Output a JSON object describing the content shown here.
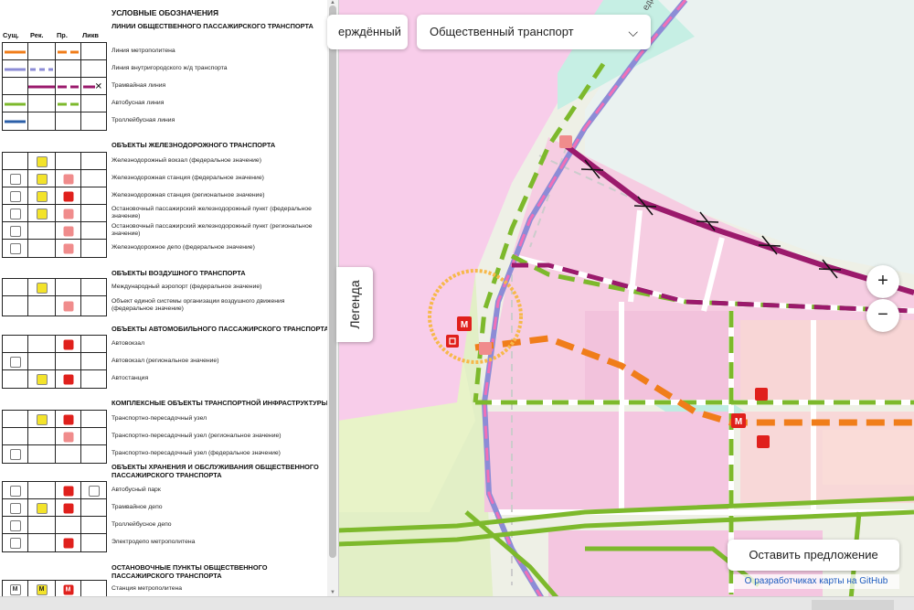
{
  "legend": {
    "title": "УСЛОВНЫЕ ОБОЗНАЧЕНИЯ",
    "columns": [
      "Сущ.",
      "Рек.",
      "Пр.",
      "Ликв"
    ],
    "sections": [
      {
        "title": "ЛИНИИ ОБЩЕСТВЕННОГО ПАССАЖИРСКОГО ТРАНСПОРТА",
        "items": [
          {
            "label": "Линия метрополитена",
            "color": "#f07d1a"
          },
          {
            "label": "Линия внутригородского ж/д транспорта",
            "color": "#8c8cd6"
          },
          {
            "label": "Трамвайная линия",
            "color": "#9b1a6c"
          },
          {
            "label": "Автобусная линия",
            "color": "#7db92c"
          },
          {
            "label": "Троллейбусная линия",
            "color": "#2b5fa8"
          }
        ]
      },
      {
        "title": "ОБЪЕКТЫ ЖЕЛЕЗНОДОРОЖНОГО ТРАНСПОРТА",
        "items": [
          {
            "label": "Железнодорожный вокзал (федеральное значение)"
          },
          {
            "label": "Железнодорожная станция (федеральное значение)"
          },
          {
            "label": "Железнодорожная станция (региональное значение)"
          },
          {
            "label": "Остановочный пассажирский железнодорожный пункт (федеральное значение)"
          },
          {
            "label": "Остановочный пассажирский железнодорожный пункт (региональное значение)"
          },
          {
            "label": "Железнодорожное депо (федеральное значение)"
          }
        ]
      },
      {
        "title": "ОБЪЕКТЫ ВОЗДУШНОГО ТРАНСПОРТА",
        "items": [
          {
            "label": "Международный аэропорт (федеральное значение)"
          },
          {
            "label": "Объект единой системы организации воздушного движения (федеральное значение)"
          }
        ]
      },
      {
        "title": "ОБЪЕКТЫ АВТОМОБИЛЬНОГО ПАССАЖИРСКОГО ТРАНСПОРТА",
        "items": [
          {
            "label": "Автовокзал"
          },
          {
            "label": "Автовокзал (региональное значение)"
          },
          {
            "label": "Автостанция"
          }
        ]
      },
      {
        "title": "КОМПЛЕКСНЫЕ ОБЪЕКТЫ ТРАНСПОРТНОЙ ИНФРАСТРУКТУРЫ",
        "items": [
          {
            "label": "Транспортно-пересадочный узел"
          },
          {
            "label": "Транспортно-пересадочный узел (региональное значение)"
          },
          {
            "label": "Транспортно-пересадочный узел (федеральное значение)"
          }
        ]
      },
      {
        "title": "ОБЪЕКТЫ ХРАНЕНИЯ И ОБСЛУЖИВАНИЯ ОБЩЕСТВЕННОГО ПАССАЖИРСКОГО ТРАНСПОРТА",
        "items": [
          {
            "label": "Автобусный парк"
          },
          {
            "label": "Трамвайное депо"
          },
          {
            "label": "Троллейбусное депо"
          },
          {
            "label": "Электродепо метрополитена"
          }
        ]
      },
      {
        "title": "ОСТАНОВОЧНЫЕ ПУНКТЫ ОБЩЕСТВЕННОГО ПАССАЖИРСКОГО ТРАНСПОРТА",
        "items": [
          {
            "label": "Станция метрополитена",
            "glyph": "M"
          }
        ]
      }
    ]
  },
  "legend_tab": {
    "label": "Легенда"
  },
  "controls": {
    "approved_label": "ерждённый",
    "transport_select": "Общественный транспорт",
    "zoom_in": "+",
    "zoom_out": "−",
    "propose_label": "Оставить предложение",
    "github_link": "О разработчиках карты на GitHub"
  },
  "map": {
    "street_label": "еди",
    "metro_marker": "M",
    "colors": {
      "residential": "#f5c8e0",
      "commercial": "#f2b8d6",
      "water": "#b8ece0",
      "green_zone": "#e6f0c8",
      "metro": "#f07d1a",
      "tram": "#9b1a6c",
      "bus": "#7db92c",
      "rail": "#8c8cd6",
      "highlight": "#f7b84a"
    }
  }
}
